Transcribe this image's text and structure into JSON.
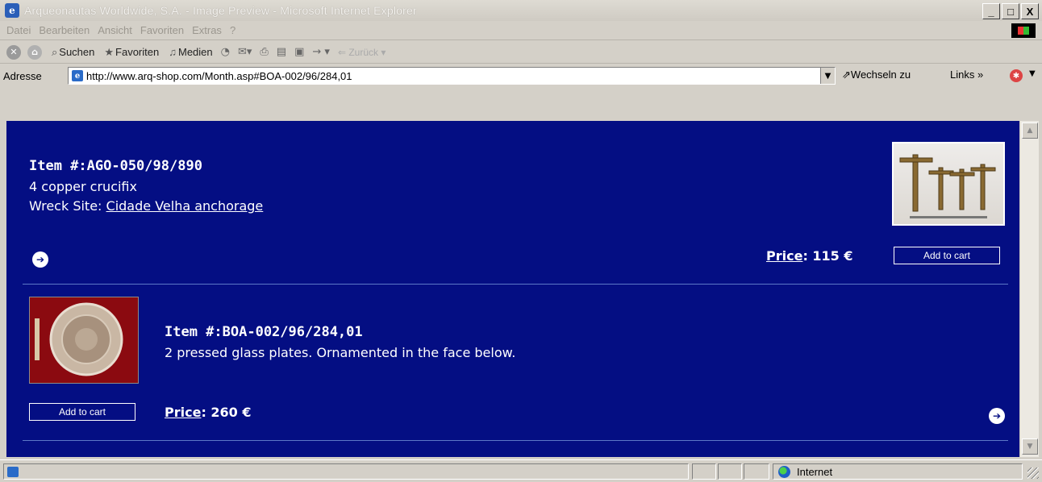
{
  "window": {
    "title": "Arqueonautas Worldwide, S.A. - Image Preview - Microsoft Internet Explorer",
    "buttons": [
      "_",
      "□",
      "X"
    ]
  },
  "menu": [
    "Datei",
    "Bearbeiten",
    "Ansicht",
    "Favoriten",
    "Extras",
    "?"
  ],
  "toolbar": {
    "search": "Suchen",
    "favorites": "Favoriten",
    "media": "Medien",
    "back": "Zurück"
  },
  "address": {
    "label": "Adresse",
    "url": "http://www.arq-shop.com/Month.asp#BOA-002/96/284,01",
    "go": "Wechseln zu",
    "links": "Links"
  },
  "items": [
    {
      "title": "Item #:AGO-050/98/890",
      "description": "4 copper crucifix",
      "wreck_label": "Wreck Site:",
      "wreck_site": "Cidade Velha anchorage",
      "price_label": "Price",
      "price_value": ": 115 €",
      "cart": "Add to cart"
    },
    {
      "title": "Item #:BOA-002/96/284,01",
      "description": "2 pressed glass plates. Ornamented in the face below.",
      "price_label": "Price",
      "price_value": ": 260 €",
      "cart": "Add to cart"
    }
  ],
  "status": {
    "zone": "Internet"
  },
  "colors": {
    "page_background": "#040e83",
    "link": "#ffffff"
  }
}
